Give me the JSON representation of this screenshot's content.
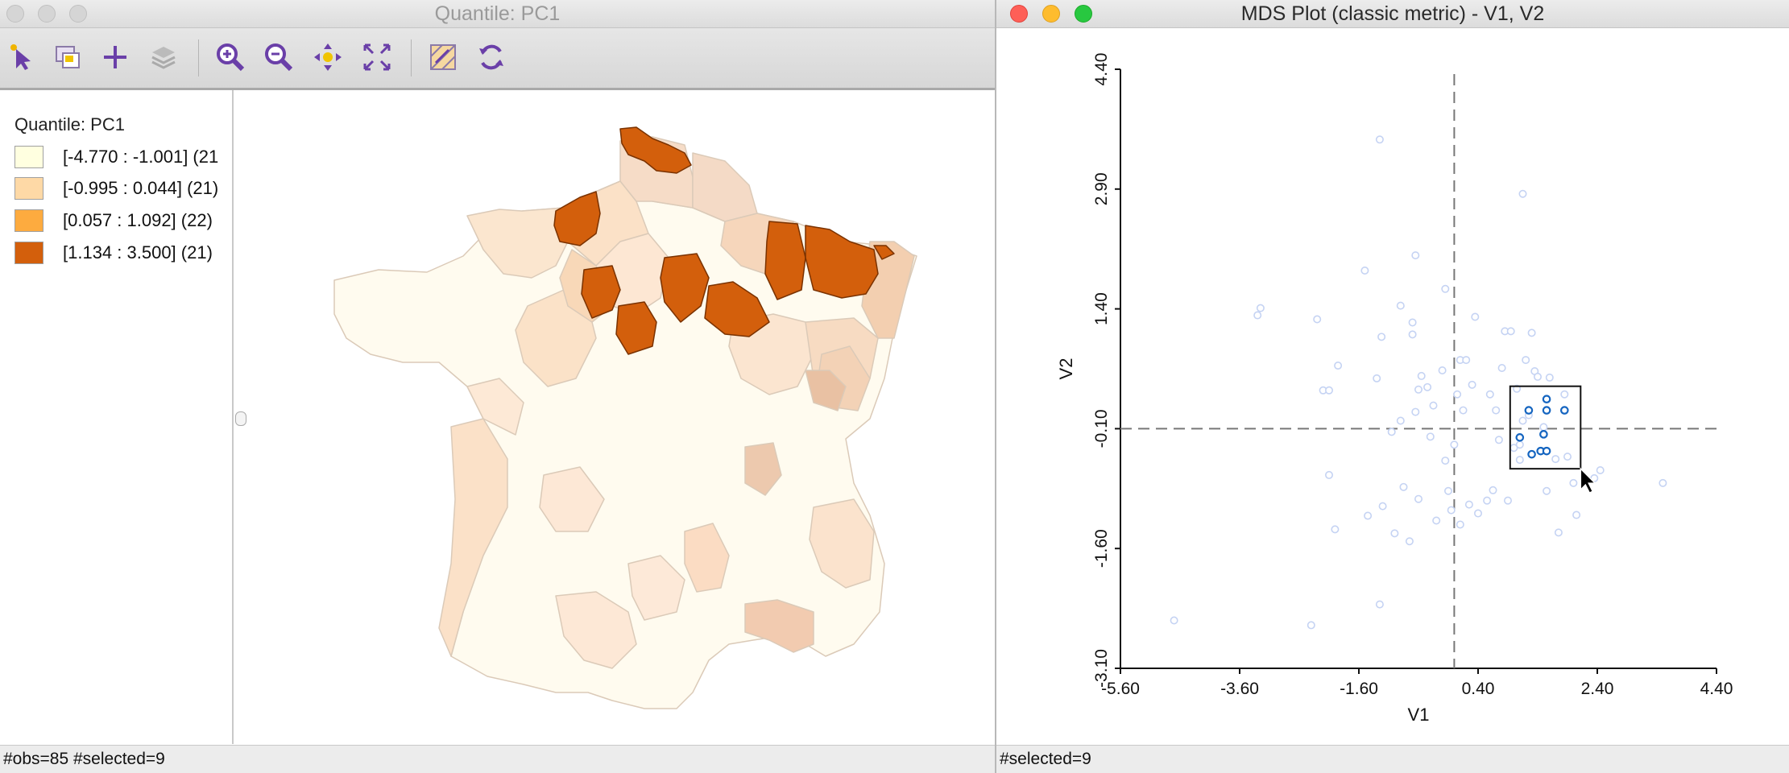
{
  "map_window": {
    "title": "Quantile: PC1",
    "legend_title": "Quantile: PC1",
    "legend": [
      {
        "label": "[-4.770 : -1.001] (21",
        "color": "#ffffe0"
      },
      {
        "label": "[-0.995 : 0.044] (21)",
        "color": "#fed9a6"
      },
      {
        "label": "[0.057 : 1.092] (22)",
        "color": "#fdab3f"
      },
      {
        "label": "[1.134 : 3.500] (21)",
        "color": "#d35f0c"
      }
    ],
    "status": "#obs=85 #selected=9",
    "toolbar": [
      "select-pointer-icon",
      "select-shape-icon",
      "add-icon",
      "layers-icon",
      "zoom-in-icon",
      "zoom-out-icon",
      "pan-icon",
      "fit-extent-icon",
      "map-brush-icon",
      "refresh-icon"
    ]
  },
  "mds_window": {
    "title": "MDS Plot (classic metric) - V1, V2",
    "status": "#selected=9"
  },
  "chart_data": {
    "type": "scatter",
    "xlabel": "V1",
    "ylabel": "V2",
    "xlim": [
      -5.6,
      4.4
    ],
    "ylim": [
      -3.1,
      4.4
    ],
    "xticks": [
      "-5.60",
      "-3.60",
      "-1.60",
      "0.40",
      "2.40",
      "4.40"
    ],
    "yticks": [
      "-3.10",
      "-1.60",
      "-0.10",
      "1.40",
      "2.90",
      "4.40"
    ],
    "reference_lines": {
      "x": 0.0,
      "y": -0.1
    },
    "selection_color": "#1565c0",
    "unselected_color": "#c5d3f3",
    "points": [
      {
        "x": -4.7,
        "y": -2.5,
        "selected": false
      },
      {
        "x": -3.3,
        "y": 1.32,
        "selected": false
      },
      {
        "x": -3.25,
        "y": 1.41,
        "selected": false
      },
      {
        "x": -2.4,
        "y": -2.56,
        "selected": false
      },
      {
        "x": -2.3,
        "y": 1.27,
        "selected": false
      },
      {
        "x": -2.2,
        "y": 0.38,
        "selected": false
      },
      {
        "x": -2.1,
        "y": 0.38,
        "selected": false
      },
      {
        "x": -2.1,
        "y": -0.68,
        "selected": false
      },
      {
        "x": -2.0,
        "y": -1.36,
        "selected": false
      },
      {
        "x": -1.95,
        "y": 0.69,
        "selected": false
      },
      {
        "x": -1.5,
        "y": 1.88,
        "selected": false
      },
      {
        "x": -1.45,
        "y": -1.19,
        "selected": false
      },
      {
        "x": -1.3,
        "y": 0.53,
        "selected": false
      },
      {
        "x": -1.25,
        "y": 3.52,
        "selected": false
      },
      {
        "x": -1.25,
        "y": -2.3,
        "selected": false
      },
      {
        "x": -1.22,
        "y": 1.05,
        "selected": false
      },
      {
        "x": -1.2,
        "y": -1.07,
        "selected": false
      },
      {
        "x": -1.05,
        "y": -0.14,
        "selected": false
      },
      {
        "x": -1.0,
        "y": -1.41,
        "selected": false
      },
      {
        "x": -0.9,
        "y": 1.44,
        "selected": false
      },
      {
        "x": -0.9,
        "y": 0.0,
        "selected": false
      },
      {
        "x": -0.85,
        "y": -0.83,
        "selected": false
      },
      {
        "x": -0.75,
        "y": -1.51,
        "selected": false
      },
      {
        "x": -0.7,
        "y": 1.23,
        "selected": false
      },
      {
        "x": -0.7,
        "y": 1.08,
        "selected": false
      },
      {
        "x": -0.65,
        "y": 2.07,
        "selected": false
      },
      {
        "x": -0.65,
        "y": 0.11,
        "selected": false
      },
      {
        "x": -0.6,
        "y": 0.39,
        "selected": false
      },
      {
        "x": -0.6,
        "y": -0.98,
        "selected": false
      },
      {
        "x": -0.55,
        "y": 0.56,
        "selected": false
      },
      {
        "x": -0.45,
        "y": 0.42,
        "selected": false
      },
      {
        "x": -0.4,
        "y": -0.2,
        "selected": false
      },
      {
        "x": -0.35,
        "y": 0.19,
        "selected": false
      },
      {
        "x": -0.3,
        "y": -1.25,
        "selected": false
      },
      {
        "x": -0.2,
        "y": 0.63,
        "selected": false
      },
      {
        "x": -0.15,
        "y": 1.65,
        "selected": false
      },
      {
        "x": -0.15,
        "y": -0.5,
        "selected": false
      },
      {
        "x": -0.1,
        "y": -0.88,
        "selected": false
      },
      {
        "x": -0.05,
        "y": -1.12,
        "selected": false
      },
      {
        "x": 0.0,
        "y": -0.3,
        "selected": false
      },
      {
        "x": 0.05,
        "y": 0.33,
        "selected": false
      },
      {
        "x": 0.1,
        "y": 0.76,
        "selected": false
      },
      {
        "x": 0.1,
        "y": -1.3,
        "selected": false
      },
      {
        "x": 0.15,
        "y": 0.13,
        "selected": false
      },
      {
        "x": 0.2,
        "y": 0.76,
        "selected": false
      },
      {
        "x": 0.25,
        "y": -1.05,
        "selected": false
      },
      {
        "x": 0.3,
        "y": 0.45,
        "selected": false
      },
      {
        "x": 0.35,
        "y": 1.3,
        "selected": false
      },
      {
        "x": 0.4,
        "y": -1.16,
        "selected": false
      },
      {
        "x": 0.55,
        "y": -1.0,
        "selected": false
      },
      {
        "x": 0.6,
        "y": 0.33,
        "selected": false
      },
      {
        "x": 0.65,
        "y": -0.87,
        "selected": false
      },
      {
        "x": 0.7,
        "y": 0.13,
        "selected": false
      },
      {
        "x": 0.75,
        "y": -0.24,
        "selected": false
      },
      {
        "x": 0.8,
        "y": 0.66,
        "selected": false
      },
      {
        "x": 0.85,
        "y": 1.12,
        "selected": false
      },
      {
        "x": 0.9,
        "y": -1.0,
        "selected": false
      },
      {
        "x": 0.95,
        "y": 1.12,
        "selected": false
      },
      {
        "x": 1.0,
        "y": -0.34,
        "selected": false
      },
      {
        "x": 1.05,
        "y": 0.4,
        "selected": false
      },
      {
        "x": 1.1,
        "y": -0.49,
        "selected": false
      },
      {
        "x": 1.15,
        "y": 0.0,
        "selected": false
      },
      {
        "x": 1.2,
        "y": 0.76,
        "selected": false
      },
      {
        "x": 1.1,
        "y": -0.3,
        "selected": false
      },
      {
        "x": 1.15,
        "y": 2.84,
        "selected": false
      },
      {
        "x": 1.25,
        "y": 0.07,
        "selected": false
      },
      {
        "x": 1.3,
        "y": 1.1,
        "selected": false
      },
      {
        "x": 1.35,
        "y": 0.62,
        "selected": false
      },
      {
        "x": 1.4,
        "y": 0.55,
        "selected": false
      },
      {
        "x": 1.5,
        "y": -0.08,
        "selected": false
      },
      {
        "x": 1.55,
        "y": -0.88,
        "selected": false
      },
      {
        "x": 1.6,
        "y": 0.54,
        "selected": false
      },
      {
        "x": 1.7,
        "y": -0.48,
        "selected": false
      },
      {
        "x": 1.75,
        "y": -1.4,
        "selected": false
      },
      {
        "x": 1.85,
        "y": 0.33,
        "selected": false
      },
      {
        "x": 1.9,
        "y": -0.45,
        "selected": false
      },
      {
        "x": 2.0,
        "y": -0.78,
        "selected": false
      },
      {
        "x": 2.05,
        "y": -1.18,
        "selected": false
      },
      {
        "x": 2.2,
        "y": -0.76,
        "selected": false
      },
      {
        "x": 2.35,
        "y": -0.72,
        "selected": false
      },
      {
        "x": 2.45,
        "y": -0.62,
        "selected": false
      },
      {
        "x": 3.5,
        "y": -0.78,
        "selected": false
      },
      {
        "x": 1.25,
        "y": 0.13,
        "selected": true
      },
      {
        "x": 1.55,
        "y": 0.13,
        "selected": true
      },
      {
        "x": 1.85,
        "y": 0.13,
        "selected": true
      },
      {
        "x": 1.55,
        "y": 0.27,
        "selected": true
      },
      {
        "x": 1.5,
        "y": -0.17,
        "selected": true
      },
      {
        "x": 1.45,
        "y": -0.38,
        "selected": true
      },
      {
        "x": 1.55,
        "y": -0.38,
        "selected": true
      },
      {
        "x": 1.1,
        "y": -0.21,
        "selected": true
      },
      {
        "x": 1.3,
        "y": -0.42,
        "selected": true
      }
    ]
  }
}
